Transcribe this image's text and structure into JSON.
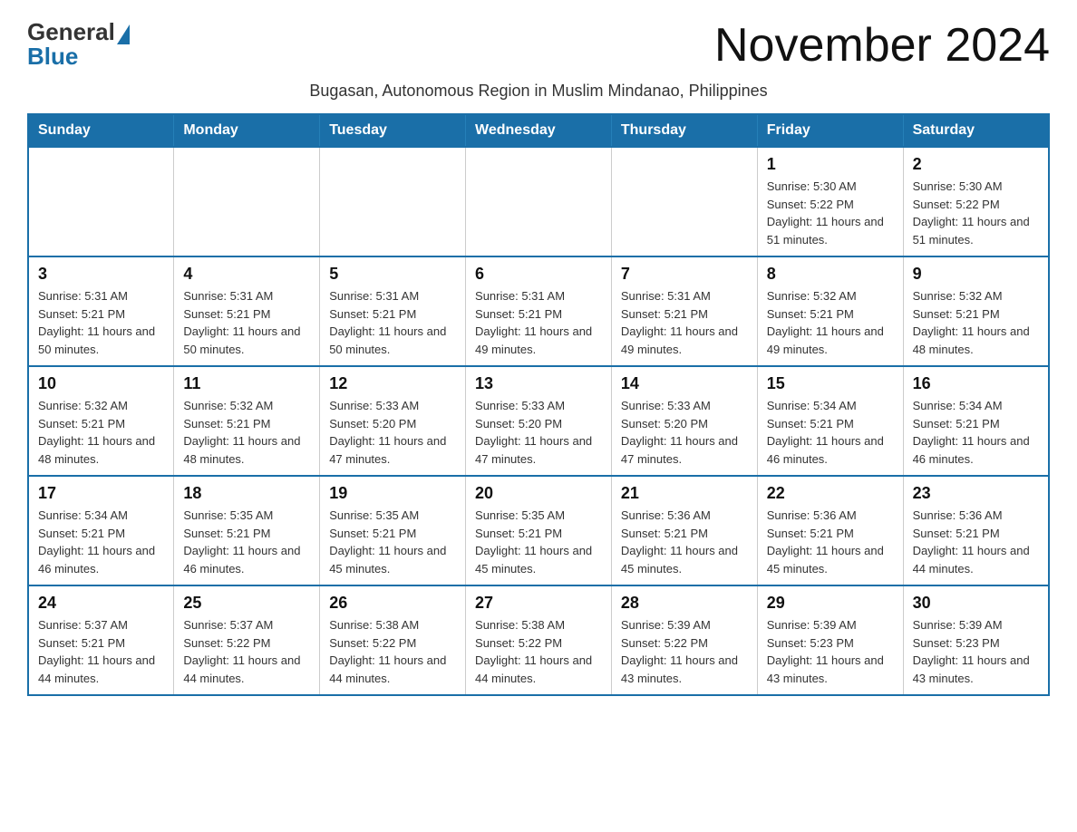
{
  "logo": {
    "general": "General",
    "blue": "Blue"
  },
  "header": {
    "month_title": "November 2024",
    "subtitle": "Bugasan, Autonomous Region in Muslim Mindanao, Philippines"
  },
  "days_of_week": [
    "Sunday",
    "Monday",
    "Tuesday",
    "Wednesday",
    "Thursday",
    "Friday",
    "Saturday"
  ],
  "weeks": [
    [
      {
        "day": "",
        "info": ""
      },
      {
        "day": "",
        "info": ""
      },
      {
        "day": "",
        "info": ""
      },
      {
        "day": "",
        "info": ""
      },
      {
        "day": "",
        "info": ""
      },
      {
        "day": "1",
        "info": "Sunrise: 5:30 AM\nSunset: 5:22 PM\nDaylight: 11 hours and 51 minutes."
      },
      {
        "day": "2",
        "info": "Sunrise: 5:30 AM\nSunset: 5:22 PM\nDaylight: 11 hours and 51 minutes."
      }
    ],
    [
      {
        "day": "3",
        "info": "Sunrise: 5:31 AM\nSunset: 5:21 PM\nDaylight: 11 hours and 50 minutes."
      },
      {
        "day": "4",
        "info": "Sunrise: 5:31 AM\nSunset: 5:21 PM\nDaylight: 11 hours and 50 minutes."
      },
      {
        "day": "5",
        "info": "Sunrise: 5:31 AM\nSunset: 5:21 PM\nDaylight: 11 hours and 50 minutes."
      },
      {
        "day": "6",
        "info": "Sunrise: 5:31 AM\nSunset: 5:21 PM\nDaylight: 11 hours and 49 minutes."
      },
      {
        "day": "7",
        "info": "Sunrise: 5:31 AM\nSunset: 5:21 PM\nDaylight: 11 hours and 49 minutes."
      },
      {
        "day": "8",
        "info": "Sunrise: 5:32 AM\nSunset: 5:21 PM\nDaylight: 11 hours and 49 minutes."
      },
      {
        "day": "9",
        "info": "Sunrise: 5:32 AM\nSunset: 5:21 PM\nDaylight: 11 hours and 48 minutes."
      }
    ],
    [
      {
        "day": "10",
        "info": "Sunrise: 5:32 AM\nSunset: 5:21 PM\nDaylight: 11 hours and 48 minutes."
      },
      {
        "day": "11",
        "info": "Sunrise: 5:32 AM\nSunset: 5:21 PM\nDaylight: 11 hours and 48 minutes."
      },
      {
        "day": "12",
        "info": "Sunrise: 5:33 AM\nSunset: 5:20 PM\nDaylight: 11 hours and 47 minutes."
      },
      {
        "day": "13",
        "info": "Sunrise: 5:33 AM\nSunset: 5:20 PM\nDaylight: 11 hours and 47 minutes."
      },
      {
        "day": "14",
        "info": "Sunrise: 5:33 AM\nSunset: 5:20 PM\nDaylight: 11 hours and 47 minutes."
      },
      {
        "day": "15",
        "info": "Sunrise: 5:34 AM\nSunset: 5:21 PM\nDaylight: 11 hours and 46 minutes."
      },
      {
        "day": "16",
        "info": "Sunrise: 5:34 AM\nSunset: 5:21 PM\nDaylight: 11 hours and 46 minutes."
      }
    ],
    [
      {
        "day": "17",
        "info": "Sunrise: 5:34 AM\nSunset: 5:21 PM\nDaylight: 11 hours and 46 minutes."
      },
      {
        "day": "18",
        "info": "Sunrise: 5:35 AM\nSunset: 5:21 PM\nDaylight: 11 hours and 46 minutes."
      },
      {
        "day": "19",
        "info": "Sunrise: 5:35 AM\nSunset: 5:21 PM\nDaylight: 11 hours and 45 minutes."
      },
      {
        "day": "20",
        "info": "Sunrise: 5:35 AM\nSunset: 5:21 PM\nDaylight: 11 hours and 45 minutes."
      },
      {
        "day": "21",
        "info": "Sunrise: 5:36 AM\nSunset: 5:21 PM\nDaylight: 11 hours and 45 minutes."
      },
      {
        "day": "22",
        "info": "Sunrise: 5:36 AM\nSunset: 5:21 PM\nDaylight: 11 hours and 45 minutes."
      },
      {
        "day": "23",
        "info": "Sunrise: 5:36 AM\nSunset: 5:21 PM\nDaylight: 11 hours and 44 minutes."
      }
    ],
    [
      {
        "day": "24",
        "info": "Sunrise: 5:37 AM\nSunset: 5:21 PM\nDaylight: 11 hours and 44 minutes."
      },
      {
        "day": "25",
        "info": "Sunrise: 5:37 AM\nSunset: 5:22 PM\nDaylight: 11 hours and 44 minutes."
      },
      {
        "day": "26",
        "info": "Sunrise: 5:38 AM\nSunset: 5:22 PM\nDaylight: 11 hours and 44 minutes."
      },
      {
        "day": "27",
        "info": "Sunrise: 5:38 AM\nSunset: 5:22 PM\nDaylight: 11 hours and 44 minutes."
      },
      {
        "day": "28",
        "info": "Sunrise: 5:39 AM\nSunset: 5:22 PM\nDaylight: 11 hours and 43 minutes."
      },
      {
        "day": "29",
        "info": "Sunrise: 5:39 AM\nSunset: 5:23 PM\nDaylight: 11 hours and 43 minutes."
      },
      {
        "day": "30",
        "info": "Sunrise: 5:39 AM\nSunset: 5:23 PM\nDaylight: 11 hours and 43 minutes."
      }
    ]
  ]
}
